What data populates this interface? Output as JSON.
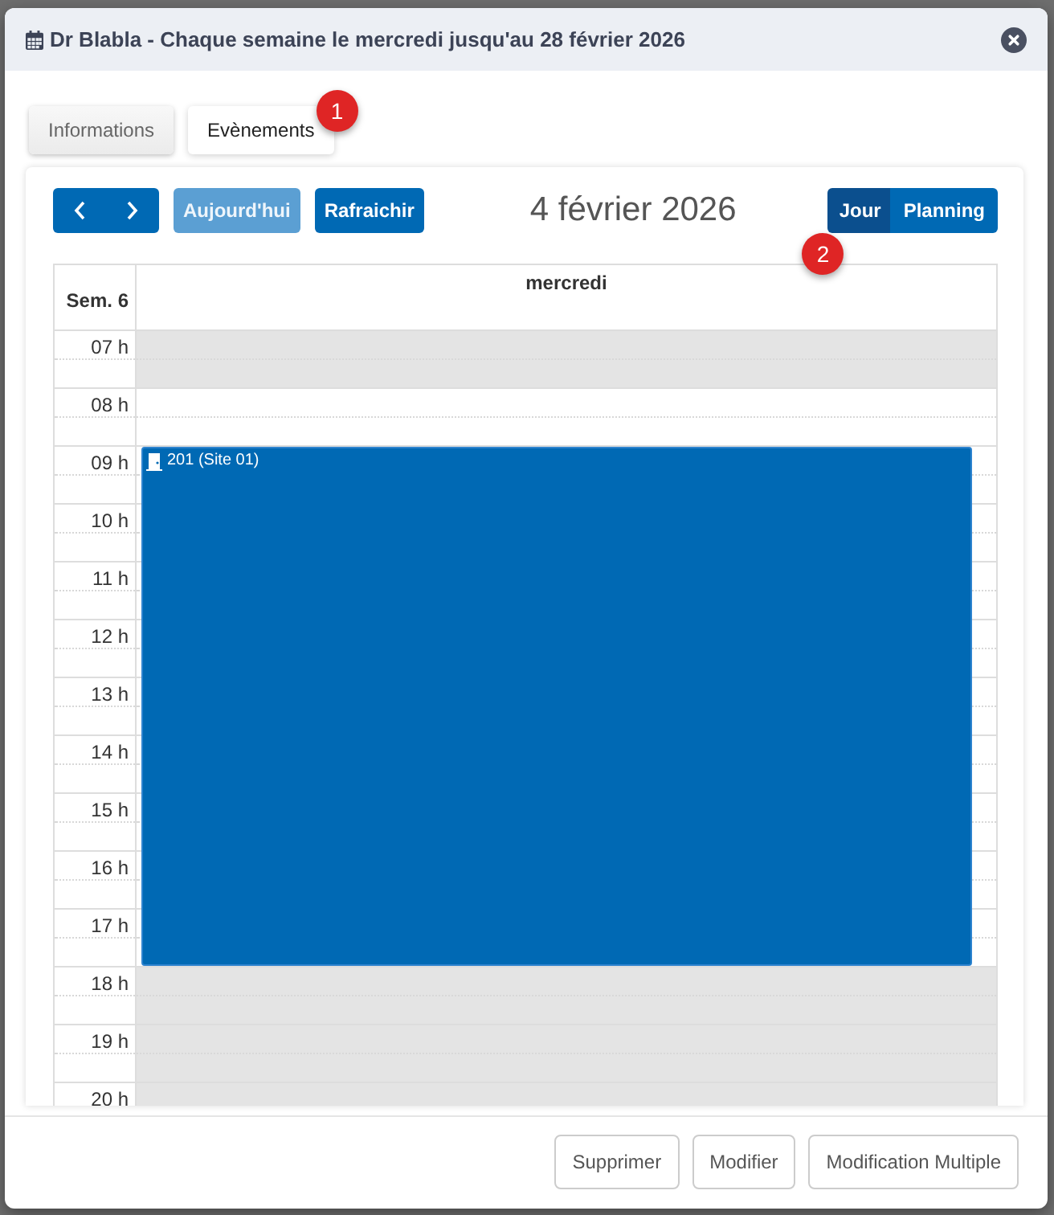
{
  "dialog": {
    "title": "Dr Blabla - Chaque semaine le mercredi jusqu'au 28 février 2026"
  },
  "tabs": [
    {
      "label": "Informations",
      "selected": false
    },
    {
      "label": "Evènements",
      "selected": true,
      "marker": "1"
    }
  ],
  "toolbar": {
    "today_button": {
      "label": "Aujourd'hui",
      "disabled": true
    },
    "refresh_button": {
      "label": "Rafraichir",
      "disabled": false
    },
    "title": "4 février 2026",
    "views": [
      {
        "label": "Jour",
        "selected": true,
        "marker": "2"
      },
      {
        "label": "Planning",
        "selected": false
      }
    ]
  },
  "calendar": {
    "week_label": "Sem. 6",
    "day": "mercredi",
    "hours": [
      {
        "label": "07 h",
        "shaded": true,
        "booked": false
      },
      {
        "label": "08 h",
        "shaded": false,
        "booked": false
      },
      {
        "label": "09 h",
        "shaded": false,
        "booked": true
      },
      {
        "label": "10 h",
        "shaded": false,
        "booked": true
      },
      {
        "label": "11 h",
        "shaded": false,
        "booked": true
      },
      {
        "label": "12 h",
        "shaded": false,
        "booked": true
      },
      {
        "label": "13 h",
        "shaded": false,
        "booked": true
      },
      {
        "label": "14 h",
        "shaded": false,
        "booked": true
      },
      {
        "label": "15 h",
        "shaded": false,
        "booked": true
      },
      {
        "label": "16 h",
        "shaded": false,
        "booked": true
      },
      {
        "label": "17 h",
        "shaded": false,
        "booked": true
      },
      {
        "label": "18 h",
        "shaded": true,
        "booked": false
      },
      {
        "label": "19 h",
        "shaded": true,
        "booked": false
      },
      {
        "label": "20 h",
        "shaded": true,
        "booked": false
      }
    ],
    "events": [
      {
        "title": "201 (Site 01)"
      }
    ]
  },
  "footer_buttons": [
    "Supprimer",
    "Modifier",
    "Modification Multiple"
  ]
}
